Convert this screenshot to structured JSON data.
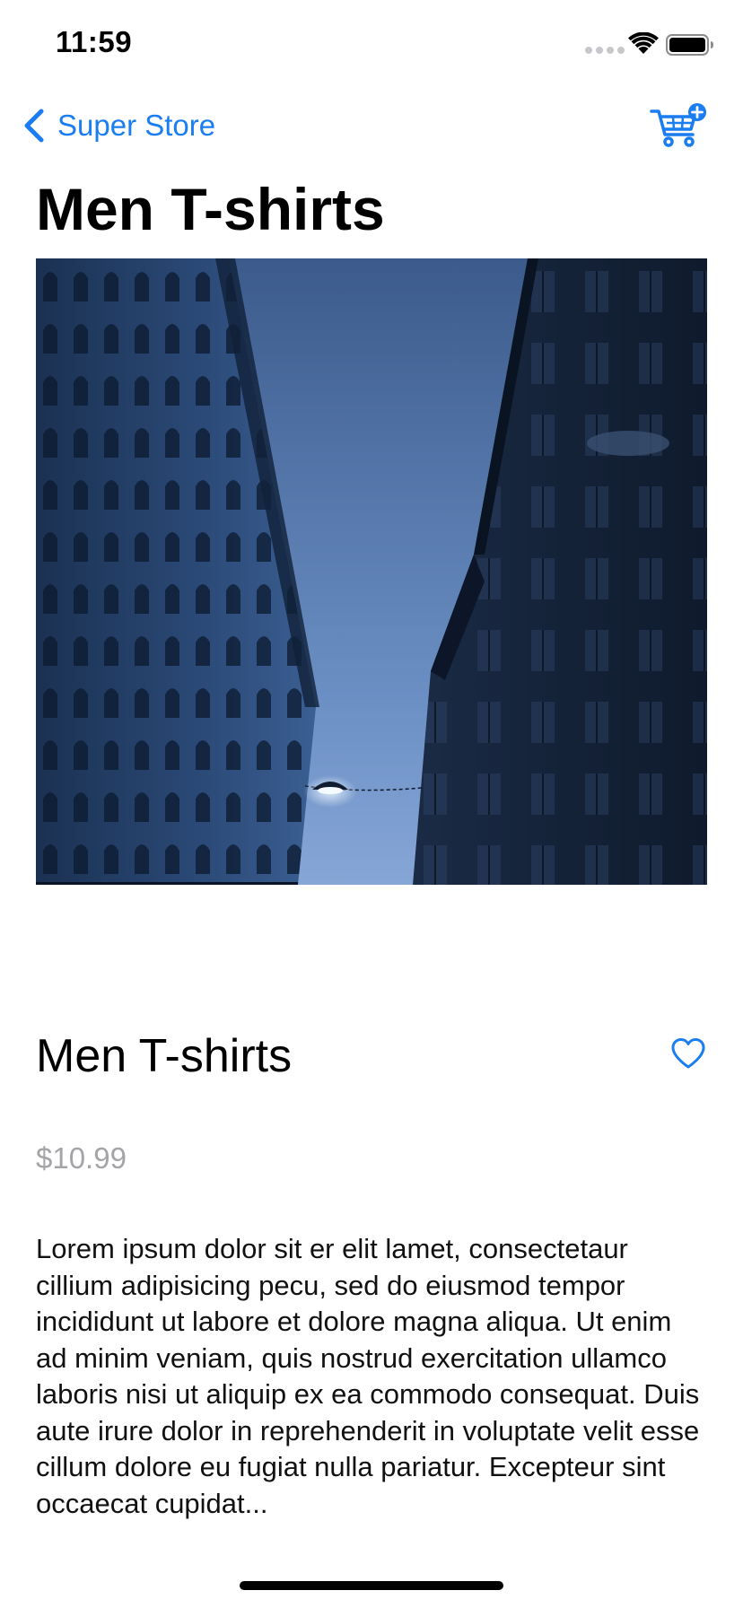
{
  "status_bar": {
    "time": "11:59"
  },
  "nav": {
    "back_label": "Super Store",
    "cart_icon": "cart-add-icon"
  },
  "page": {
    "title": "Men T-shirts"
  },
  "product": {
    "name": "Men T-shirts",
    "price": "$10.99",
    "description": "Lorem ipsum dolor sit er elit lamet, consectetaur cillium adipisicing pecu, sed do eiusmod tempor incididunt ut labore et dolore magna aliqua. Ut enim ad minim veniam, quis nostrud exercitation ullamco laboris nisi ut aliquip ex ea commodo consequat. Duis aute irure dolor in reprehenderit in voluptate velit esse cillum dolore eu fugiat nulla pariatur. Excepteur sint occaecat cupidat...",
    "favorited": false
  },
  "colors": {
    "accent": "#1a7df0",
    "price_gray": "#a4a4a8",
    "sky": "#5b7eb0"
  }
}
